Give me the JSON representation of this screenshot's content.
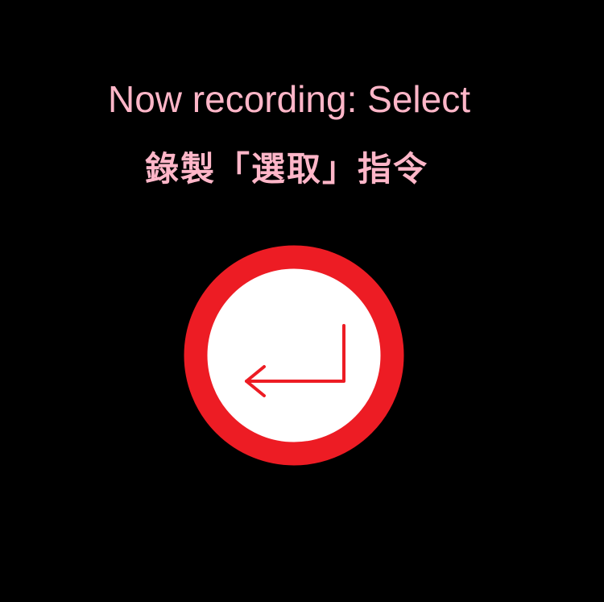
{
  "status": {
    "title_en": "Now recording: Select",
    "title_zh": "錄製「選取」指令"
  },
  "record_button": {
    "icon": "enter-return-icon",
    "ring_color": "#ED1C24",
    "fill_color": "#FFFFFF",
    "text_color": "#FFB6C8"
  }
}
